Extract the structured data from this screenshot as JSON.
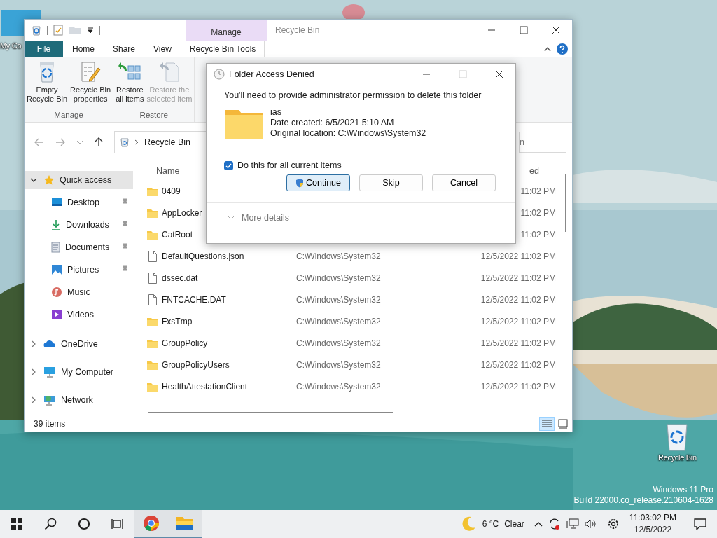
{
  "desktop": {
    "icons": [
      {
        "label": "My Co",
        "kind": "computer"
      },
      {
        "label": "Recycle Bin",
        "kind": "recycle"
      }
    ],
    "watermark": [
      "Windows 11 Pro",
      "Build 22000.co_release.210604-1628"
    ]
  },
  "explorer": {
    "title": "Recycle Bin",
    "context_tab": "Manage",
    "tabs": [
      {
        "label": "File",
        "kind": "file",
        "selected": false
      },
      {
        "label": "Home",
        "kind": "tab",
        "selected": false
      },
      {
        "label": "Share",
        "kind": "tab",
        "selected": false
      },
      {
        "label": "View",
        "kind": "tab",
        "selected": false
      },
      {
        "label": "Recycle Bin Tools",
        "kind": "tab",
        "selected": true
      }
    ],
    "ribbon_groups": [
      {
        "label": "Manage",
        "buttons": [
          {
            "label": "Empty\nRecycle Bin",
            "disabled": false
          },
          {
            "label": "Recycle Bin\nproperties",
            "disabled": false
          }
        ]
      },
      {
        "label": "Restore",
        "buttons": [
          {
            "label": "Restore\nall items",
            "disabled": false
          },
          {
            "label": "Restore the\nselected item",
            "disabled": true
          }
        ]
      }
    ],
    "address": "Recycle Bin",
    "search": {
      "placeholder": "n"
    },
    "sidebar": [
      {
        "label": "Quick access",
        "expanded": true,
        "selected": true,
        "children": [
          {
            "label": "Desktop",
            "pinned": true,
            "selected": false
          },
          {
            "label": "Downloads",
            "pinned": true,
            "selected": false
          },
          {
            "label": "Documents",
            "pinned": true,
            "selected": false
          },
          {
            "label": "Pictures",
            "pinned": true,
            "selected": false
          },
          {
            "label": "Music",
            "pinned": false,
            "selected": false
          },
          {
            "label": "Videos",
            "pinned": false,
            "selected": false
          }
        ]
      },
      {
        "label": "OneDrive",
        "expanded": false,
        "selected": false
      },
      {
        "label": "My Computer",
        "expanded": false,
        "selected": false
      },
      {
        "label": "Network",
        "expanded": false,
        "selected": false
      }
    ],
    "columns": {
      "name": "Name",
      "date": "ed"
    },
    "rows": [
      {
        "name": "0409",
        "kind": "folder",
        "date": "11:02 PM"
      },
      {
        "name": "AppLocker",
        "kind": "folder",
        "date": "11:02 PM"
      },
      {
        "name": "CatRoot",
        "kind": "folder",
        "date": "11:02 PM"
      },
      {
        "name": "DefaultQuestions.json",
        "kind": "file",
        "location": "C:\\Windows\\System32",
        "date": "12/5/2022 11:02 PM"
      },
      {
        "name": "dssec.dat",
        "kind": "file",
        "location": "C:\\Windows\\System32",
        "date": "12/5/2022 11:02 PM"
      },
      {
        "name": "FNTCACHE.DAT",
        "kind": "file",
        "location": "C:\\Windows\\System32",
        "date": "12/5/2022 11:02 PM"
      },
      {
        "name": "FxsTmp",
        "kind": "folder",
        "location": "C:\\Windows\\System32",
        "date": "12/5/2022 11:02 PM"
      },
      {
        "name": "GroupPolicy",
        "kind": "folder",
        "location": "C:\\Windows\\System32",
        "date": "12/5/2022 11:02 PM"
      },
      {
        "name": "GroupPolicyUsers",
        "kind": "folder",
        "location": "C:\\Windows\\System32",
        "date": "12/5/2022 11:02 PM"
      },
      {
        "name": "HealthAttestationClient",
        "kind": "folder",
        "location": "C:\\Windows\\System32",
        "date": "12/5/2022 11:02 PM"
      }
    ],
    "status": "39 items"
  },
  "dialog": {
    "title": "Folder Access Denied",
    "message": "You'll need to provide administrator permission to delete this folder",
    "item": {
      "name": "ias",
      "details": [
        "Date created: 6/5/2021 5:10 AM",
        "Original location: C:\\Windows\\System32"
      ]
    },
    "checkbox": {
      "label": "Do this for all current items",
      "checked": true
    },
    "buttons": [
      {
        "label": "Continue",
        "kind": "shield",
        "focused": true
      },
      {
        "label": "Skip",
        "kind": "plain",
        "focused": false
      },
      {
        "label": "Cancel",
        "kind": "plain",
        "focused": false
      }
    ],
    "more_details": "More details"
  },
  "taskbar": {
    "apps": [
      {
        "kind": "chrome",
        "active": true
      },
      {
        "kind": "explorer",
        "active": true
      }
    ],
    "weather": {
      "temp": "6 °C",
      "condition": "Clear"
    },
    "clock": {
      "time": "11:03:02 PM",
      "date": "12/5/2022"
    }
  }
}
